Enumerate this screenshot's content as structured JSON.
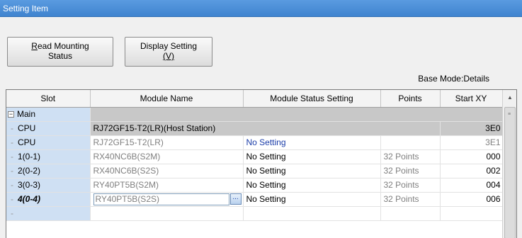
{
  "window": {
    "title": "Setting Item"
  },
  "toolbar": {
    "read_mounting_label_1": "Read Mounting",
    "read_mounting_label_2": "Status",
    "read_mounting_mnemonic": "R",
    "display_setting_label_1": "Display Setting",
    "display_setting_label_2": "(V)",
    "base_mode": "Base Mode:Details"
  },
  "table": {
    "headers": [
      "Slot",
      "Module Name",
      "Module Status Setting",
      "Points",
      "Start XY"
    ],
    "group": {
      "label": "Main",
      "expander": "−"
    },
    "rows": [
      {
        "slot": "CPU",
        "module": "RJ72GF15-T2(LR)(Host Station)",
        "status": "",
        "points": "",
        "start": "3E0",
        "style": "group-host"
      },
      {
        "slot": "CPU",
        "module": "RJ72GF15-T2(LR)",
        "status": "No Setting",
        "points": "",
        "start": "3E1",
        "style": "host"
      },
      {
        "slot": "1(0-1)",
        "module": "RX40NC6B(S2M)",
        "status": "No Setting",
        "points": "32 Points",
        "start": "000",
        "style": "normal"
      },
      {
        "slot": "2(0-2)",
        "module": "RX40NC6B(S2S)",
        "status": "No Setting",
        "points": "32 Points",
        "start": "002",
        "style": "normal"
      },
      {
        "slot": "3(0-3)",
        "module": "RY40PT5B(S2M)",
        "status": "No Setting",
        "points": "32 Points",
        "start": "004",
        "style": "normal"
      },
      {
        "slot": "4(0-4)",
        "module": "RY40PT5B(S2S)",
        "status": "No Setting",
        "points": "32 Points",
        "start": "006",
        "style": "editing"
      }
    ],
    "ellipsis_button": "..."
  },
  "icons": {
    "scroll_up": "up-arrow-icon",
    "grip": "scroll-grip-icon"
  }
}
